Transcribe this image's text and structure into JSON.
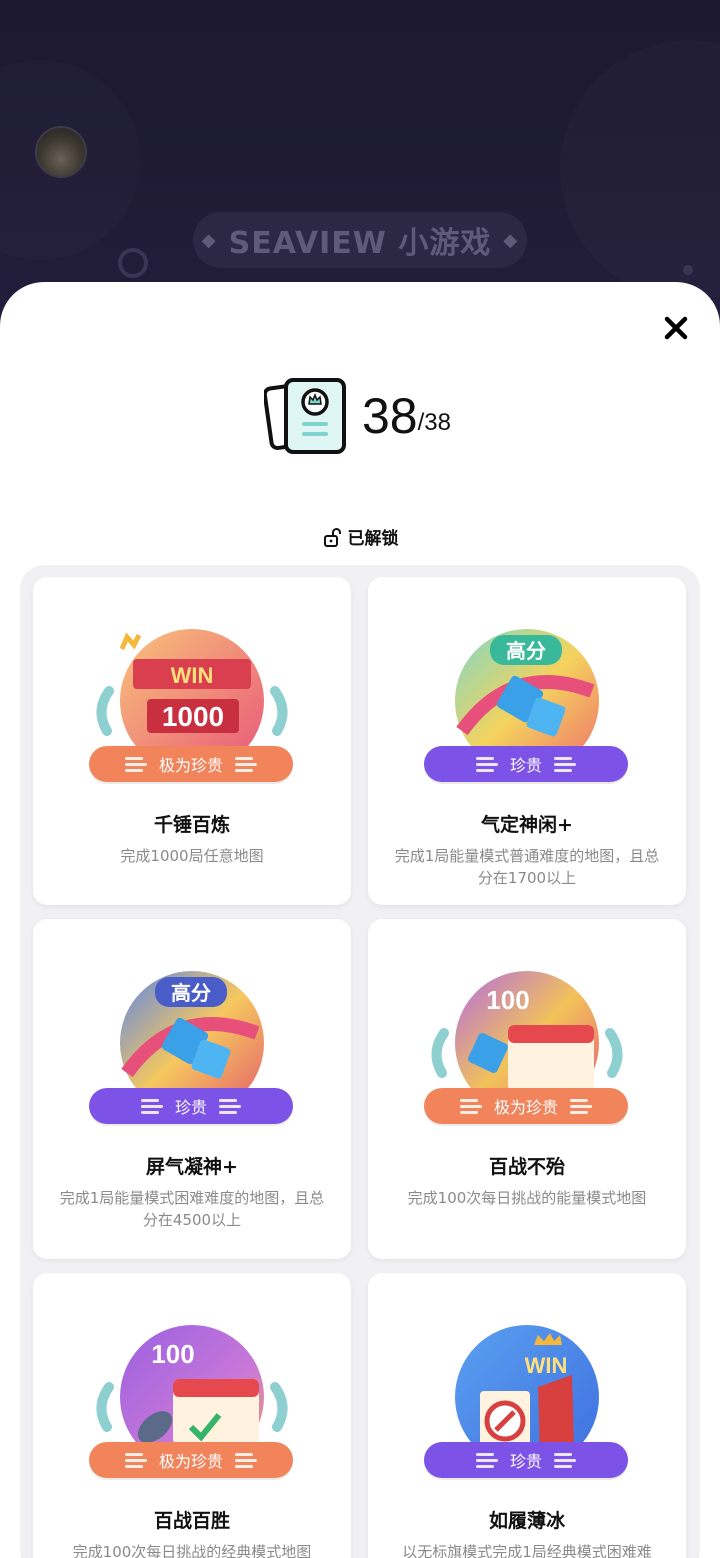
{
  "header": {
    "title": "SEAVIEW 小游戏",
    "diamond_left": "◆",
    "diamond_right": "◆"
  },
  "counter": {
    "unlocked": "38",
    "total": "/38"
  },
  "section": {
    "label": "已解锁"
  },
  "colors": {
    "orange_pill": "#f2845c",
    "purple_pill": "#7d52e6",
    "header_bg": "#1f1b33"
  },
  "achievements": [
    {
      "title": "千锤百炼",
      "desc": "完成1000局任意地图",
      "rarity": "极为珍贵",
      "badge_text": "WIN",
      "badge_number": "1000"
    },
    {
      "title": "气定神闲+",
      "desc": "完成1局能量模式普通难度的地图，且总分在1700以上",
      "rarity": "珍贵",
      "badge_text": "高分"
    },
    {
      "title": "屏气凝神+",
      "desc": "完成1局能量模式困难难度的地图，且总分在4500以上",
      "rarity": "珍贵",
      "badge_text": "高分"
    },
    {
      "title": "百战不殆",
      "desc": "完成100次每日挑战的能量模式地图",
      "rarity": "极为珍贵",
      "badge_number": "100"
    },
    {
      "title": "百战百胜",
      "desc": "完成100次每日挑战的经典模式地图",
      "rarity": "极为珍贵",
      "badge_number": "100"
    },
    {
      "title": "如履薄冰",
      "desc": "以无标旗模式完成1局经典模式困难难",
      "rarity": "珍贵",
      "badge_text": "WIN"
    }
  ]
}
